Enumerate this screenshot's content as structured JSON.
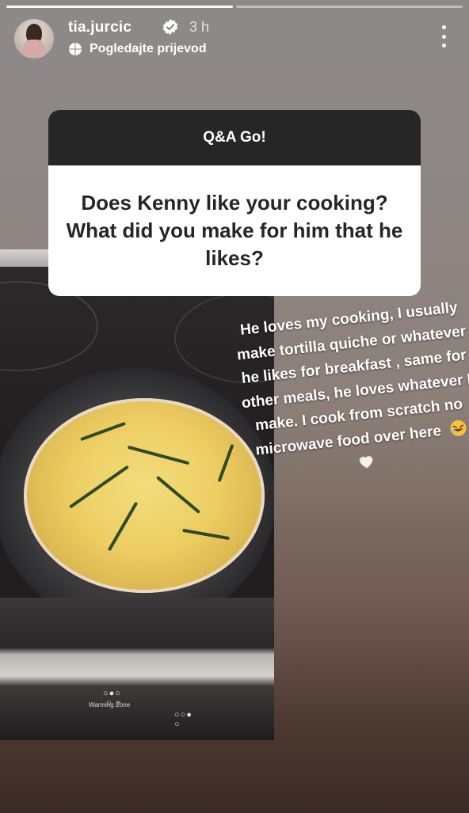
{
  "story": {
    "username": "tia.jurcic",
    "time": "3 h",
    "translate_label": "Pogledajte prijevod",
    "progress_segments": 2,
    "progress_completed": 1
  },
  "question_sticker": {
    "header": "Q&A Go!",
    "question": "Does Kenny like your cooking? What did you make for him that he likes?"
  },
  "answer": {
    "text": "He loves my cooking, I usually make tortilla quiche or whatever he likes for breakfast , same for other meals, he loves whatever I make. I cook from scratch no microwave food over here"
  },
  "photo": {
    "stove_label": "Warming Zone"
  },
  "icons": {
    "verified": "verified-badge-icon",
    "translate": "globe-icon",
    "more": "more-options-icon",
    "emojis": [
      "rolling-laughing-emoji",
      "white-heart-emoji"
    ]
  },
  "colors": {
    "sticker_header_bg": "#262626",
    "sticker_body_bg": "#ffffff",
    "text_primary": "#ffffff"
  }
}
